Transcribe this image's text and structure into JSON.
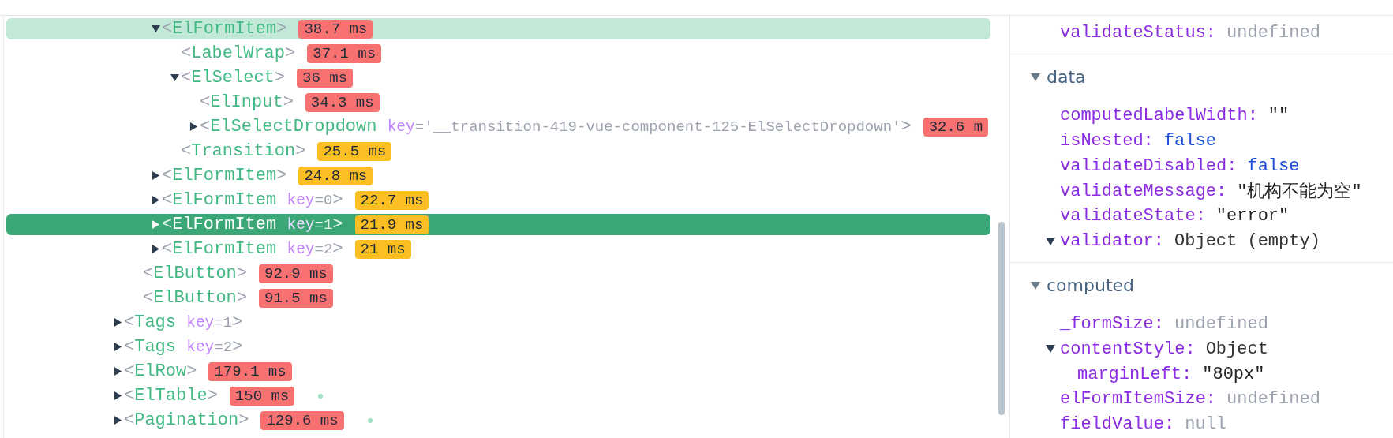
{
  "tree": [
    {
      "children": [
        {
          "children": [
            {
              "open": "<",
              "name": "ElFormItem",
              "close": ">",
              "time": "38.7 ms",
              "color": "#f87171",
              "expanded": true,
              "selected": false,
              "hovered": true,
              "marker": false,
              "children": [
                {
                  "open": "<",
                  "name": "LabelWrap",
                  "close": ">",
                  "time": "37.1 ms",
                  "color": "#f87171",
                  "selected": false,
                  "hovered": false,
                  "marker": false
                },
                {
                  "open": "<",
                  "name": "ElSelect",
                  "close": ">",
                  "time": "36 ms",
                  "color": "#f87171",
                  "expanded": true,
                  "selected": false,
                  "hovered": false,
                  "marker": false,
                  "children": [
                    {
                      "open": "<",
                      "name": "ElInput",
                      "close": ">",
                      "time": "34.3 ms",
                      "color": "#f87171",
                      "selected": false,
                      "hovered": false,
                      "marker": false
                    },
                    {
                      "open": "<",
                      "name": "ElSelectDropdown",
                      "attr": "key",
                      "attr_value": "='__transition-419-vue-component-125-ElSelectDropdown'",
                      "close": ">",
                      "time": "32.6 m",
                      "color": "#f87171",
                      "expanded": false,
                      "selected": false,
                      "hovered": false,
                      "marker": false
                    }
                  ]
                },
                {
                  "open": "<",
                  "name": "Transition",
                  "close": ">",
                  "time": "25.5 ms",
                  "color": "#fbbf24",
                  "selected": false,
                  "hovered": false,
                  "marker": false
                }
              ]
            },
            {
              "open": "<",
              "name": "ElFormItem",
              "close": ">",
              "time": "24.8 ms",
              "color": "#fbbf24",
              "expanded": false,
              "selected": false,
              "hovered": false,
              "marker": false
            },
            {
              "open": "<",
              "name": "ElFormItem",
              "attr": "key",
              "attr_value": "=0",
              "close": ">",
              "time": "22.7 ms",
              "color": "#fbbf24",
              "expanded": false,
              "selected": false,
              "hovered": false,
              "marker": false
            },
            {
              "open": "<",
              "name": "ElFormItem",
              "attr": "key",
              "attr_value": "=1",
              "close": ">",
              "time": "21.9 ms",
              "color": "#fbbf24",
              "expanded": false,
              "selected": true,
              "hovered": false,
              "marker": false
            },
            {
              "open": "<",
              "name": "ElFormItem",
              "attr": "key",
              "attr_value": "=2",
              "close": ">",
              "time": "21 ms",
              "color": "#fbbf24",
              "expanded": false,
              "selected": false,
              "hovered": false,
              "marker": false
            }
          ]
        },
        {
          "open": "<",
          "name": "ElButton",
          "close": ">",
          "time": "92.9 ms",
          "color": "#f87171",
          "selected": false,
          "hovered": false,
          "marker": false
        },
        {
          "open": "<",
          "name": "ElButton",
          "close": ">",
          "time": "91.5 ms",
          "color": "#f87171",
          "selected": false,
          "hovered": false,
          "marker": false
        }
      ]
    },
    {
      "open": "<",
      "name": "Tags",
      "attr": "key",
      "attr_value": "=1",
      "close": ">",
      "expanded": false,
      "selected": false,
      "hovered": false,
      "marker": false
    },
    {
      "open": "<",
      "name": "Tags",
      "attr": "key",
      "attr_value": "=2",
      "close": ">",
      "expanded": false,
      "selected": false,
      "hovered": false,
      "marker": false
    },
    {
      "open": "<",
      "name": "ElRow",
      "close": ">",
      "time": "179.1 ms",
      "color": "#f87171",
      "expanded": false,
      "selected": false,
      "hovered": false,
      "marker": false
    },
    {
      "open": "<",
      "name": "ElTable",
      "close": ">",
      "time": "150 ms",
      "color": "#f87171",
      "expanded": false,
      "selected": false,
      "hovered": false,
      "marker": true
    },
    {
      "open": "<",
      "name": "Pagination",
      "close": ">",
      "time": "129.6 ms",
      "color": "#f87171",
      "expanded": false,
      "selected": false,
      "hovered": false,
      "marker": true
    }
  ],
  "inspector": {
    "sections": [
      {
        "items": [
          {
            "key": "validateStatus:",
            "value": "undefined",
            "kind": "undefined"
          }
        ]
      },
      {
        "title": "data",
        "expanded": true,
        "items": [
          {
            "key": "computedLabelWidth:",
            "value": "\"\"",
            "kind": "string"
          },
          {
            "key": "isNested:",
            "value": "false",
            "kind": "boolean"
          },
          {
            "key": "validateDisabled:",
            "value": "false",
            "kind": "boolean"
          },
          {
            "key": "validateMessage:",
            "value": "\"机构不能为空\"",
            "kind": "string"
          },
          {
            "key": "validateState:",
            "value": "\"error\"",
            "kind": "string"
          },
          {
            "key": "validator:",
            "value": "Object (empty)",
            "kind": "object",
            "expanded": true
          }
        ]
      },
      {
        "title": "computed",
        "expanded": true,
        "items": [
          {
            "key": "_formSize:",
            "value": "undefined",
            "kind": "undefined"
          },
          {
            "key": "contentStyle:",
            "value": "Object",
            "kind": "object",
            "expanded": true,
            "children": [
              {
                "key": "marginLeft:",
                "value": "\"80px\"",
                "kind": "string"
              }
            ]
          },
          {
            "key": "elFormItemSize:",
            "value": "undefined",
            "kind": "undefined"
          },
          {
            "key": "fieldValue:",
            "value": "null",
            "kind": "null"
          }
        ]
      }
    ]
  }
}
